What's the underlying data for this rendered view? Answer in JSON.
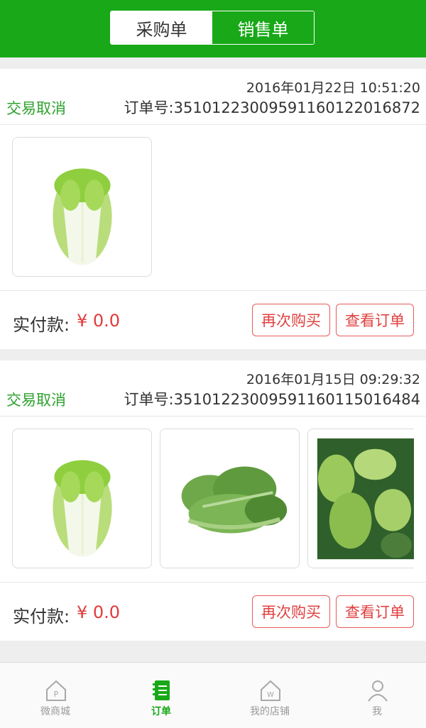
{
  "header": {
    "tabs": [
      "采购单",
      "销售单"
    ]
  },
  "orders": [
    {
      "date": "2016年01月22日 10:51:20",
      "status": "交易取消",
      "order_no": "订单号:351012230095911601220168​72",
      "paid_label": "实付款:",
      "paid_amount": "¥ 0.0",
      "rebuy": "再次购买",
      "view": "查看订单",
      "products": [
        "cabbage-image"
      ]
    },
    {
      "date": "2016年01月15日 09:29:32",
      "status": "交易取消",
      "order_no": "订单号:3510122300959116011501648​4",
      "paid_label": "实付款:",
      "paid_amount": "¥ 0.0",
      "rebuy": "再次购买",
      "view": "查看订单",
      "products": [
        "cabbage-image",
        "greens-image",
        "bokchoy-image"
      ]
    }
  ],
  "tabbar": {
    "items": [
      "微商城",
      "订单",
      "我的店铺",
      "我"
    ],
    "active": "订单",
    "accent": "#18a818"
  }
}
